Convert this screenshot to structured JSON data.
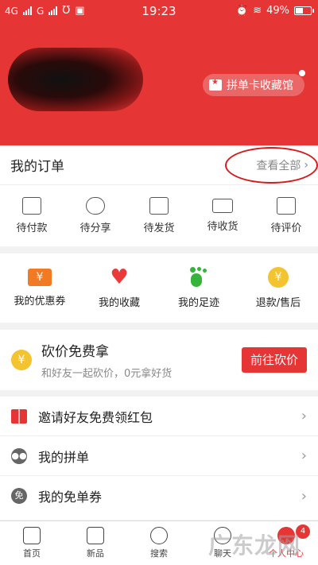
{
  "status_bar": {
    "network_left": "4G",
    "network_right": "G",
    "time": "19:23",
    "battery": "49%"
  },
  "header": {
    "collect_label": "拼单卡收藏馆"
  },
  "orders": {
    "title": "我的订单",
    "view_all": "查看全部",
    "items": [
      {
        "label": "待付款",
        "icon": "wallet-icon"
      },
      {
        "label": "待分享",
        "icon": "share-people-icon"
      },
      {
        "label": "待发货",
        "icon": "box-icon"
      },
      {
        "label": "待收货",
        "icon": "truck-icon"
      },
      {
        "label": "待评价",
        "icon": "edit-icon"
      }
    ]
  },
  "services": {
    "items": [
      {
        "label": "我的优惠券",
        "icon": "coupon-icon"
      },
      {
        "label": "我的收藏",
        "icon": "heart-icon"
      },
      {
        "label": "我的足迹",
        "icon": "footprint-icon"
      },
      {
        "label": "退款/售后",
        "icon": "refund-icon"
      }
    ]
  },
  "bargain": {
    "title": "砍价免费拿",
    "subtitle": "和好友一起砍价，0元拿好货",
    "button": "前往砍价"
  },
  "menu": {
    "items": [
      {
        "label": "邀请好友免费领红包",
        "icon": "gift-icon"
      },
      {
        "label": "我的拼单",
        "icon": "group-icon"
      },
      {
        "label": "我的免单券",
        "icon": "free-coupon-icon",
        "glyph": "免"
      }
    ]
  },
  "bottom_nav": {
    "items": [
      {
        "label": "首页",
        "icon": "home-icon"
      },
      {
        "label": "新品",
        "icon": "new-bag-icon"
      },
      {
        "label": "搜索",
        "icon": "search-icon"
      },
      {
        "label": "聊天",
        "icon": "chat-icon"
      },
      {
        "label": "个人中心",
        "icon": "profile-icon",
        "badge": "4"
      }
    ]
  },
  "watermark": "广东龙网",
  "colors": {
    "brand_red": "#e53535",
    "annotation_ring": "#d41b1b"
  }
}
